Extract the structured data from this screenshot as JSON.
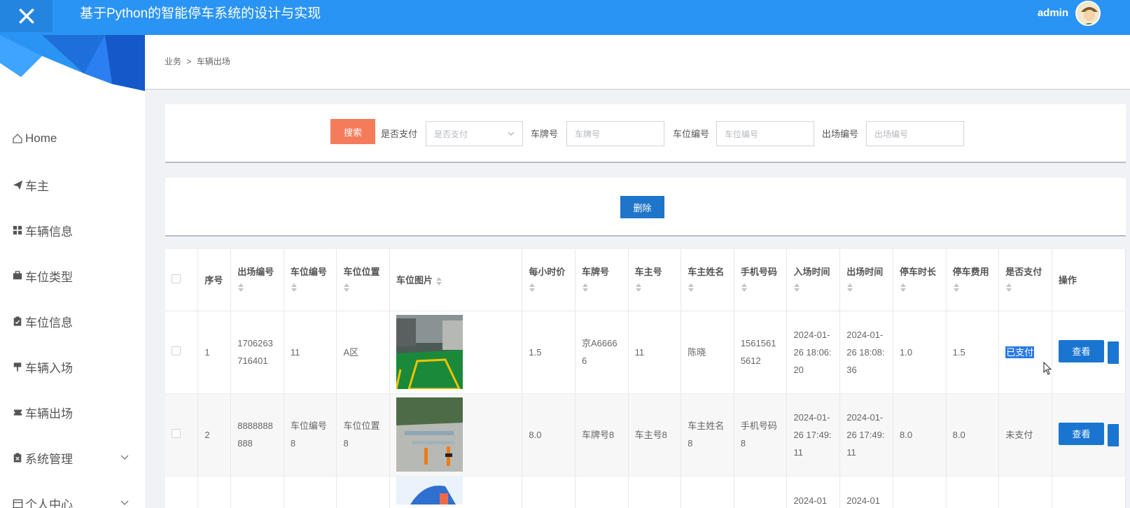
{
  "header": {
    "title": "基于Python的智能停车系统的设计与实现",
    "user": "admin",
    "accent": "#2a94f5"
  },
  "sidebar": {
    "items": [
      {
        "label": "Home",
        "icon": "home-icon"
      },
      {
        "label": "车主",
        "icon": "paper-plane-icon"
      },
      {
        "label": "车辆信息",
        "icon": "grid-icon"
      },
      {
        "label": "车位类型",
        "icon": "briefcase-icon"
      },
      {
        "label": "车位信息",
        "icon": "clipboard-check-icon"
      },
      {
        "label": "车辆入场",
        "icon": "signpost-icon"
      },
      {
        "label": "车辆出场",
        "icon": "ticket-icon"
      },
      {
        "label": "系统管理",
        "icon": "clipboard-x-icon",
        "expandable": true
      },
      {
        "label": "个人中心",
        "icon": "calendar-icon",
        "expandable": true
      }
    ]
  },
  "breadcrumb": {
    "parent": "业务",
    "separator": ">",
    "current": "车辆出场"
  },
  "search": {
    "button": "搜索",
    "paid_label": "是否支付",
    "paid_placeholder": "是否支付",
    "plate_label": "车牌号",
    "plate_placeholder": "车牌号",
    "spot_label": "车位编号",
    "spot_placeholder": "车位编号",
    "exit_label": "出场编号",
    "exit_placeholder": "出场编号"
  },
  "actions": {
    "delete": "删除"
  },
  "table": {
    "headers": {
      "index": "序号",
      "exit_no": "出场编号",
      "spot_no": "车位编号",
      "spot_loc": "车位位置",
      "spot_img": "车位图片",
      "hourly": "每小时价",
      "plate": "车牌号",
      "owner_no": "车主号",
      "owner_name": "车主姓名",
      "phone": "手机号码",
      "in_time": "入场时间",
      "out_time": "出场时间",
      "duration": "停车时长",
      "fee": "停车费用",
      "paid": "是否支付",
      "ops": "操作"
    },
    "rows": [
      {
        "index": "1",
        "exit_no": "1706263716401",
        "spot_no": "11",
        "spot_loc": "A区",
        "hourly": "1.5",
        "plate": "京A66666",
        "owner_no": "11",
        "owner_name": "陈晓",
        "phone": "15615615612",
        "in_time": "2024-01-26 18:06:20",
        "out_time": "2024-01-26 18:08:36",
        "duration": "1.0",
        "fee": "1.5",
        "paid": "已支付",
        "view": "查看"
      },
      {
        "index": "2",
        "exit_no": "8888888888",
        "spot_no": "车位编号8",
        "spot_loc": "车位位置8",
        "hourly": "8.0",
        "plate": "车牌号8",
        "owner_no": "车主号8",
        "owner_name": "车主姓名8",
        "phone": "手机号码8",
        "in_time": "2024-01-26 17:49:11",
        "out_time": "2024-01-26 17:49:11",
        "duration": "8.0",
        "fee": "8.0",
        "paid": "未支付",
        "view": "查看"
      },
      {
        "in_time": "2024-01",
        "out_time": "2024-01"
      }
    ]
  }
}
